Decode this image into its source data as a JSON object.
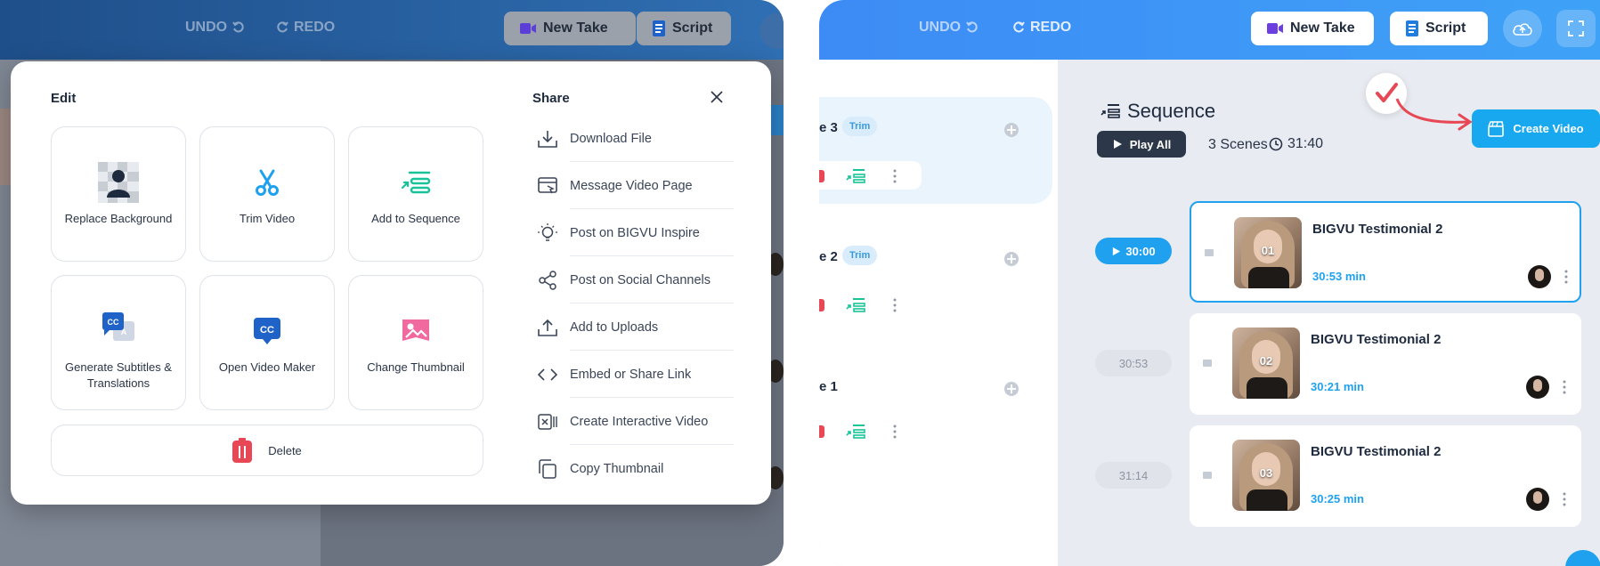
{
  "left": {
    "toolbar": {
      "undo_label": "UNDO",
      "redo_label": "REDO",
      "new_take_label": "New Take",
      "script_label": "Script"
    },
    "modal": {
      "edit_title": "Edit",
      "share_title": "Share",
      "tiles": [
        {
          "label": "Replace Background",
          "icon": "person-background-icon"
        },
        {
          "label": "Trim Video",
          "icon": "scissors-icon"
        },
        {
          "label": "Add to Sequence",
          "icon": "sequence-icon"
        },
        {
          "label": "Generate Subtitles & Translations",
          "icon": "subtitles-icon"
        },
        {
          "label": "Open Video Maker",
          "icon": "cc-icon"
        },
        {
          "label": "Change Thumbnail",
          "icon": "image-icon"
        }
      ],
      "delete_label": "Delete",
      "share_items": [
        {
          "label": "Download File",
          "icon": "download-icon"
        },
        {
          "label": "Message Video Page",
          "icon": "message-page-icon"
        },
        {
          "label": "Post on BIGVU Inspire",
          "icon": "bulb-icon"
        },
        {
          "label": "Post on Social Channels",
          "icon": "share-icon"
        },
        {
          "label": "Add to Uploads",
          "icon": "upload-icon"
        },
        {
          "label": "Embed or Share Link",
          "icon": "code-icon"
        },
        {
          "label": "Create Interactive Video",
          "icon": "interactive-icon"
        },
        {
          "label": "Copy Thumbnail",
          "icon": "copy-icon"
        }
      ]
    }
  },
  "right": {
    "toolbar": {
      "undo_label": "UNDO",
      "redo_label": "REDO",
      "new_take_label": "New Take",
      "script_label": "Script"
    },
    "scenes": [
      {
        "name": "e 3",
        "trim_label": "Trim",
        "active": true
      },
      {
        "name": "e 2",
        "trim_label": "Trim",
        "active": false
      },
      {
        "name": "e 1",
        "trim_label": "",
        "active": false
      }
    ],
    "sequence": {
      "title": "Sequence",
      "play_all_label": "Play All",
      "scenes_count": "3 Scenes",
      "duration": "31:40",
      "create_video_label": "Create Video",
      "clips": [
        {
          "time": "30:00",
          "number": "01",
          "title": "BIGVU Testimonial 2",
          "length": "30:53 min",
          "active": true
        },
        {
          "time": "30:53",
          "number": "02",
          "title": "BIGVU Testimonial 2",
          "length": "30:21 min",
          "active": false
        },
        {
          "time": "31:14",
          "number": "03",
          "title": "BIGVU Testimonial 2",
          "length": "30:25 min",
          "active": false
        }
      ]
    }
  },
  "colors": {
    "accent": "#1fa1ef",
    "danger": "#e84855",
    "sequence_green": "#19c39a"
  }
}
